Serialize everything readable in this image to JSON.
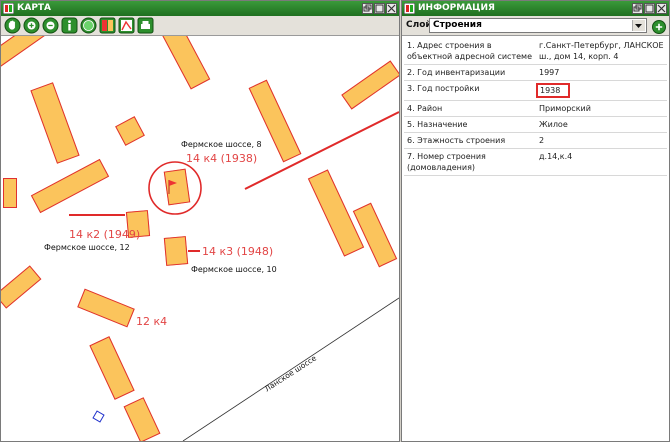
{
  "map": {
    "title": "КАРТА",
    "labels": {
      "address_8": "Фермское шоссе, 8",
      "address_12": "Фермское шоссе, 12",
      "address_10": "Фермское шоссе, 10",
      "road": "Ланское шоссе"
    },
    "annotations": {
      "k4": "14 к4 (1938)",
      "k2": "14 к2 (1949)",
      "k3": "14 к3 (1948)",
      "k12": "12 к4"
    },
    "tools": [
      "pan-icon",
      "zoom-in-icon",
      "zoom-out-icon",
      "info-icon",
      "globe-icon",
      "layers-icon",
      "map-icon",
      "print-icon"
    ]
  },
  "info": {
    "title": "ИНФОРМАЦИЯ",
    "layer_label": "Слой",
    "layer_value": "Строения",
    "rows": [
      {
        "key": "1. Адрес строения в объектной адресной системе",
        "value": "г.Санкт-Петербург, ЛАНСКОЕ ш., дом 14, корп. 4"
      },
      {
        "key": "2. Год инвентаризации",
        "value": "1997"
      },
      {
        "key": "3. Год постройки",
        "value": "1938"
      },
      {
        "key": "4. Район",
        "value": "Приморский"
      },
      {
        "key": "5. Назначение",
        "value": "Жилое"
      },
      {
        "key": "6. Этажность строения",
        "value": "2"
      },
      {
        "key": "7. Номер строения (домовладения)",
        "value": "д.14,к.4"
      }
    ]
  },
  "colors": {
    "title_green": "#2a8a2a",
    "building_fill": "#fbc45c",
    "building_border": "#e03030",
    "annotation_red": "#e24545"
  }
}
